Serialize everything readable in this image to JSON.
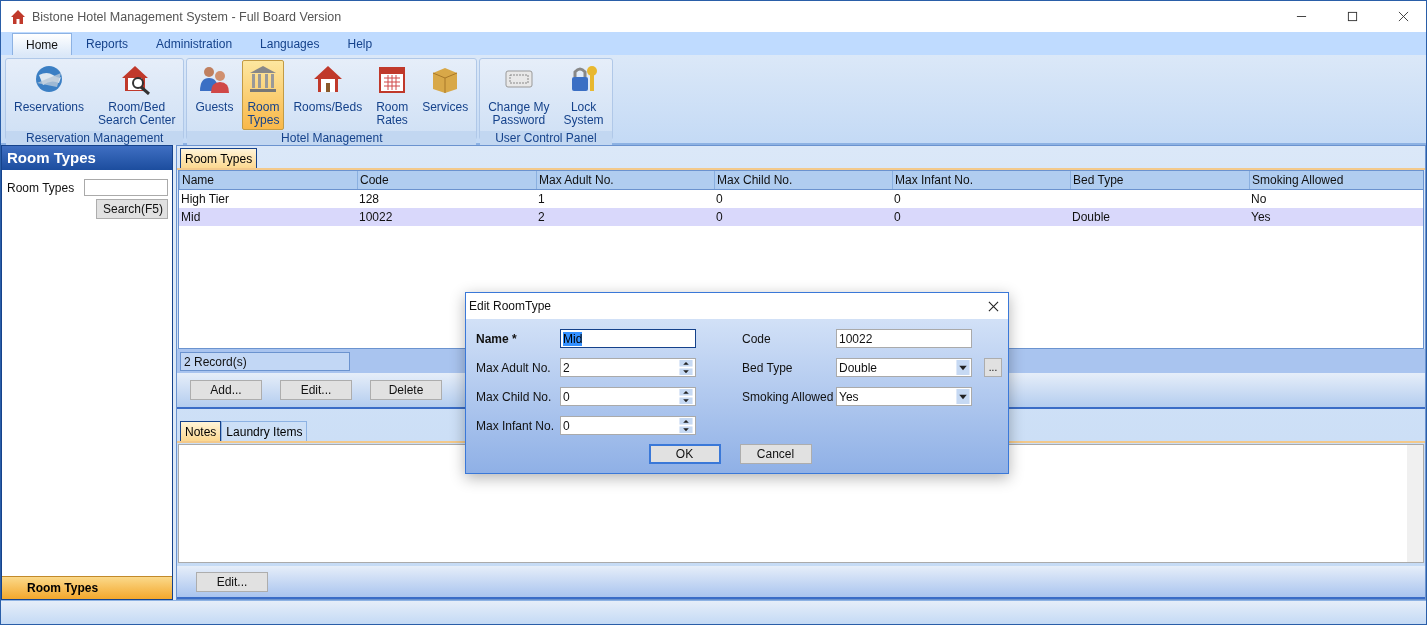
{
  "window": {
    "title": "Bistone Hotel Management System - Full Board Version"
  },
  "menu_tabs": [
    {
      "label": "Home",
      "selected": true
    },
    {
      "label": "Reports",
      "selected": false
    },
    {
      "label": "Administration",
      "selected": false
    },
    {
      "label": "Languages",
      "selected": false
    },
    {
      "label": "Help",
      "selected": false
    }
  ],
  "ribbon_groups": [
    {
      "title": "Reservation Management",
      "items": [
        {
          "lines": [
            "Reservations"
          ],
          "selected": false
        },
        {
          "lines": [
            "Room/Bed",
            "Search Center"
          ],
          "selected": false
        }
      ]
    },
    {
      "title": "Hotel Management",
      "items": [
        {
          "lines": [
            "Guests"
          ],
          "selected": false
        },
        {
          "lines": [
            "Room",
            "Types"
          ],
          "selected": true
        },
        {
          "lines": [
            "Rooms/Beds"
          ],
          "selected": false
        },
        {
          "lines": [
            "Room",
            "Rates"
          ],
          "selected": false
        },
        {
          "lines": [
            "Services"
          ],
          "selected": false
        }
      ]
    },
    {
      "title": "User Control Panel",
      "items": [
        {
          "lines": [
            "Change My",
            "Password"
          ],
          "selected": false
        },
        {
          "lines": [
            "Lock",
            "System"
          ],
          "selected": false
        }
      ]
    }
  ],
  "sidebar": {
    "title": "Room Types",
    "filter_label": "Room Types",
    "search_button": "Search(F5)",
    "footer_button": "Room Types"
  },
  "main_tabs": [
    {
      "label": "Room Types",
      "selected": true
    }
  ],
  "table": {
    "columns": [
      "Name",
      "Code",
      "Max Adult No.",
      "Max Child No.",
      "Max Infant No.",
      "Bed Type",
      "Smoking Allowed"
    ],
    "rows": [
      {
        "cells": [
          "High Tier",
          "128",
          "1",
          "0",
          "0",
          "",
          "No"
        ],
        "selected": false
      },
      {
        "cells": [
          "Mid",
          "10022",
          "2",
          "0",
          "0",
          "Double",
          "Yes"
        ],
        "selected": true
      }
    ]
  },
  "record_count": "2 Record(s)",
  "actions": [
    "Add...",
    "Edit...",
    "Delete"
  ],
  "detail_tabs": [
    {
      "label": "Notes",
      "selected": true
    },
    {
      "label": "Laundry Items",
      "selected": false
    }
  ],
  "detail_button": "Edit...",
  "dialog": {
    "title": "Edit RoomType",
    "left_fields": [
      {
        "label": "Name *",
        "kind": "text",
        "value": "Mid",
        "required": true,
        "focused": true
      },
      {
        "label": "Max Adult No.",
        "kind": "spin",
        "value": "2",
        "required": false,
        "focused": false
      },
      {
        "label": "Max Child No.",
        "kind": "spin",
        "value": "0",
        "required": false,
        "focused": false
      },
      {
        "label": "Max Infant No.",
        "kind": "spin",
        "value": "0",
        "required": false,
        "focused": false
      }
    ],
    "right_fields": [
      {
        "label": "Code",
        "kind": "text",
        "value": "10022"
      },
      {
        "label": "Bed Type",
        "kind": "combo_browse",
        "value": "Double",
        "browse": "..."
      },
      {
        "label": "Smoking Allowed",
        "kind": "combo",
        "value": "Yes"
      }
    ],
    "buttons": [
      {
        "label": "OK",
        "default": true
      },
      {
        "label": "Cancel",
        "default": false
      }
    ]
  }
}
